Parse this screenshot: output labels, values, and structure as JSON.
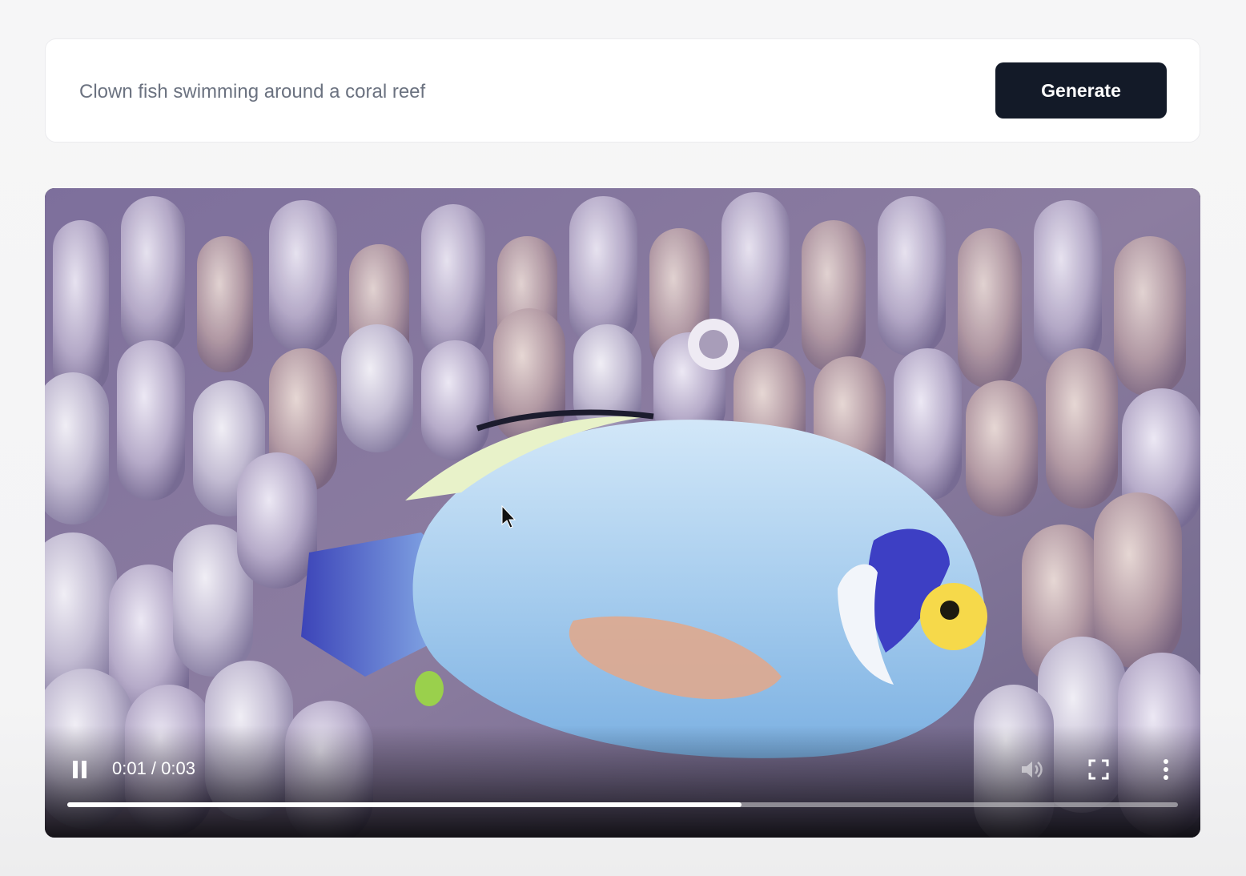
{
  "prompt": {
    "value": "Clown fish swimming around a coral reef",
    "generate_label": "Generate"
  },
  "video": {
    "time_display": "0:01 / 0:03",
    "progress": 0.607,
    "controls": {
      "play_state": "playing",
      "icons": [
        "pause-icon",
        "volume-icon",
        "fullscreen-icon",
        "more-vertical-icon"
      ]
    }
  }
}
